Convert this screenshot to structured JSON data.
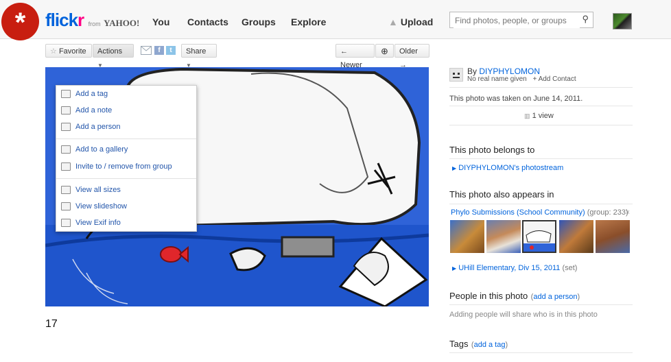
{
  "badge": {
    "symbol": "*"
  },
  "logo": {
    "part1": "flick",
    "part2": "r",
    "from": "from",
    "yahoo": "YAHOO!"
  },
  "nav": {
    "you": "You",
    "contacts": "Contacts",
    "groups": "Groups",
    "explore": "Explore",
    "upload": "Upload"
  },
  "search": {
    "placeholder": "Find photos, people, or groups"
  },
  "toolbar": {
    "favorite": "Favorite",
    "actions": "Actions",
    "share": "Share",
    "newer": "Newer",
    "older": "Older"
  },
  "menu": {
    "items": [
      {
        "label": "Add a tag",
        "icon": "tag-icon"
      },
      {
        "label": "Add a note",
        "icon": "note-icon"
      },
      {
        "label": "Add a person",
        "icon": "person-icon"
      },
      {
        "label": "Add to a gallery",
        "icon": "gallery-icon"
      },
      {
        "label": "Invite to / remove from group",
        "icon": "group-icon"
      },
      {
        "label": "View all sizes",
        "icon": "sizes-icon"
      },
      {
        "label": "View slideshow",
        "icon": "slideshow-icon"
      },
      {
        "label": "View Exif info",
        "icon": "camera-icon"
      }
    ]
  },
  "caption": "17",
  "owner": {
    "by": "By",
    "name": "DIYPHYLOMON",
    "realname": "No real name given",
    "add_contact": "+ Add Contact"
  },
  "taken": "This photo was taken on June 14, 2011.",
  "views": "1 view",
  "belongs": {
    "title": "This photo belongs to",
    "link": "DIYPHYLOMON's photostream"
  },
  "appears": {
    "title": "This photo also appears in",
    "group_name": "Phylo Submissions (School Community)",
    "group_meta": "(group: 233)",
    "close": "×",
    "set_name": "UHill Elementary, Div 15, 2011",
    "set_meta": "(set)"
  },
  "people": {
    "title": "People in this photo",
    "add": "add a person",
    "hint": "Adding people will share who is in this photo"
  },
  "tags": {
    "title": "Tags",
    "add": "add a tag"
  },
  "colors": {
    "brand_blue": "#0063dc",
    "brand_pink": "#ff0084",
    "badge_red": "#c81e10",
    "link": "#0063dc"
  }
}
